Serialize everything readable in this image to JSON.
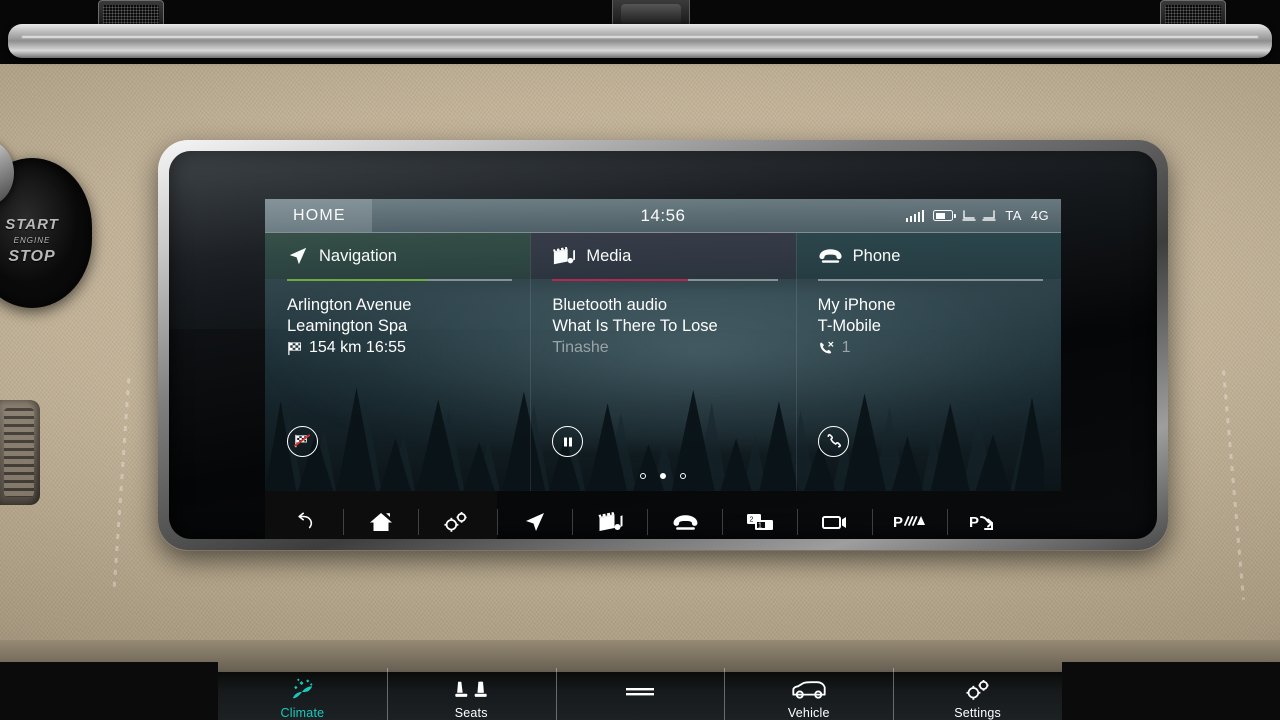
{
  "vehicle": {
    "start_button": {
      "line1": "START",
      "line2": "ENGINE",
      "line3": "STOP"
    }
  },
  "screen": {
    "status_bar": {
      "tab_label": "HOME",
      "clock": "14:56",
      "icons": [
        "signal-bars-icon",
        "battery-icon",
        "seat-heating-icon"
      ],
      "traffic_label": "TA",
      "network_label": "4G"
    },
    "cards": [
      {
        "id": "navigation",
        "title": "Navigation",
        "icon": "navigation-arrow-icon",
        "accent_color": "#6ea83c",
        "accent_percent": 62,
        "line1": "Arlington Avenue",
        "line2": "Leamington Spa",
        "detail_icon": "checkered-flag-icon",
        "detail_text": "154 km 16:55",
        "action_icon": "cancel-route-icon",
        "action_label": "Cancel route"
      },
      {
        "id": "media",
        "title": "Media",
        "icon": "media-clapper-icon",
        "accent_color": "#b4244f",
        "accent_percent": 60,
        "line1": "Bluetooth audio",
        "line2": "What Is There To Lose",
        "detail_icon": "",
        "detail_text": "Tinashe",
        "action_icon": "pause-icon",
        "action_label": "Pause"
      },
      {
        "id": "phone",
        "title": "Phone",
        "icon": "telephone-handset-icon",
        "accent_color": "#7fd4d8",
        "accent_percent": 0,
        "line1": "My iPhone",
        "line2": "T-Mobile",
        "detail_icon": "missed-call-icon",
        "detail_text": "1",
        "action_icon": "answer-call-icon",
        "action_label": "Call"
      }
    ],
    "page_indicator": {
      "total": 3,
      "active_index": 1
    },
    "nav_bar": {
      "left_items": [
        {
          "id": "back",
          "icon": "back-arrow-icon",
          "label": "Back"
        },
        {
          "id": "home",
          "icon": "home-icon",
          "label": "Home"
        },
        {
          "id": "settings",
          "icon": "gears-icon",
          "label": "Settings"
        }
      ],
      "right_items": [
        {
          "id": "navigation",
          "icon": "navigation-arrow-icon",
          "label": "Navigation"
        },
        {
          "id": "media",
          "icon": "media-clapper-icon",
          "label": "Media"
        },
        {
          "id": "phone",
          "icon": "telephone-handset-icon",
          "label": "Phone"
        },
        {
          "id": "windows",
          "icon": "split-screen-icon",
          "label": "Split screen",
          "badge_a": "2",
          "badge_b": "1"
        },
        {
          "id": "camera",
          "icon": "camera-icon",
          "label": "Camera"
        },
        {
          "id": "park-assist",
          "icon": "park-assist-icon",
          "label": "Park assist"
        },
        {
          "id": "park-exit",
          "icon": "park-exit-icon",
          "label": "Park exit"
        }
      ]
    }
  },
  "climate_bar": {
    "accent_color": "#19c9bd",
    "items": [
      {
        "id": "climate",
        "label": "Climate",
        "icon": "climate-icon",
        "active": true
      },
      {
        "id": "seats",
        "label": "Seats",
        "icon": "seats-icon",
        "active": false
      },
      {
        "id": "divider",
        "label": "",
        "icon": "bars-icon",
        "active": false
      },
      {
        "id": "vehicle",
        "label": "Vehicle",
        "icon": "car-icon",
        "active": false
      },
      {
        "id": "settings",
        "label": "Settings",
        "icon": "gears-icon",
        "active": false
      }
    ]
  }
}
